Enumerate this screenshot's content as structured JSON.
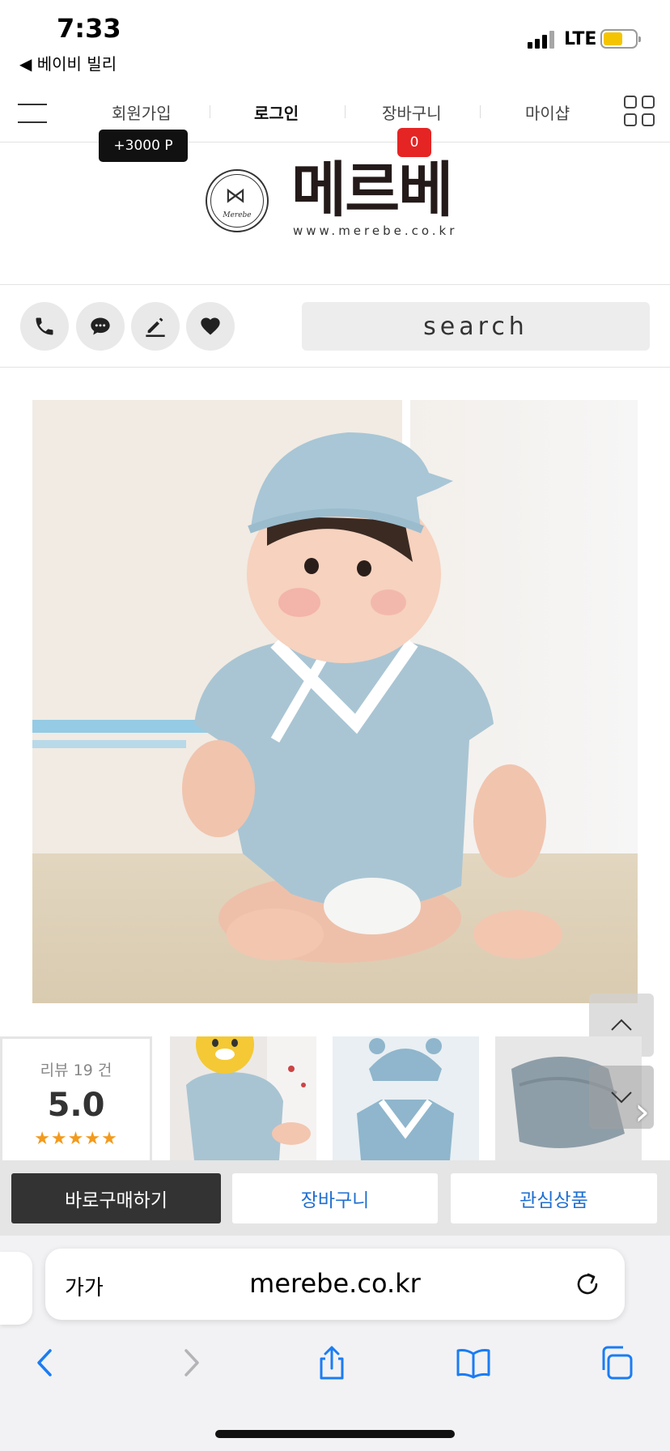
{
  "status_bar": {
    "time": "7:33",
    "back_app": "◀ 베이비 빌리",
    "network": "LTE"
  },
  "top_nav": {
    "signup": "회원가입",
    "login": "로그인",
    "cart": "장바구니",
    "myshop": "마이샵",
    "points_badge": "+3000 P",
    "cart_count": "0"
  },
  "logo": {
    "name": "메르베",
    "emblem_text": "Merebe",
    "url": "www.merebe.co.kr"
  },
  "actions": {
    "search_label": "search",
    "icons": [
      "phone-icon",
      "chat-icon",
      "edit-icon",
      "heart-icon"
    ]
  },
  "reviews": {
    "label": "리뷰 19 건",
    "score": "5.0",
    "stars": "★★★★★",
    "rating": 5
  },
  "purchase": {
    "buy_now": "바로구매하기",
    "add_cart": "장바구니",
    "wishlist": "관심상품"
  },
  "browser": {
    "text_size": "가가",
    "url": "merebe.co.kr"
  },
  "colors": {
    "cart_badge": "#e52424",
    "link_blue": "#1f6fd1",
    "star_orange": "#f39a1d",
    "ios_blue": "#1a7cf5"
  }
}
